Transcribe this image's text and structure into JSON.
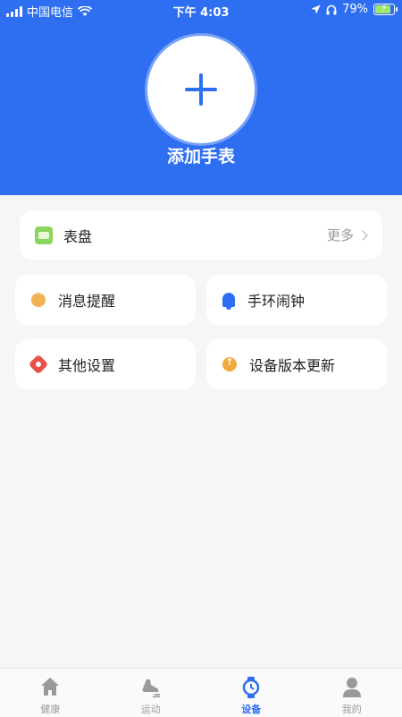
{
  "status_bar": {
    "carrier": "中国电信",
    "time": "下午 4:03",
    "battery": "79%",
    "battery_level": 0.79
  },
  "header": {
    "add_label": "添加手表",
    "accent": "#2e6ff1"
  },
  "watch_face_card": {
    "label": "表盘",
    "more": "更多",
    "icon": "watch-face-icon"
  },
  "menu": [
    {
      "label": "消息提醒",
      "icon": "message-bubble-icon"
    },
    {
      "label": "手环闹钟",
      "icon": "bell-icon"
    },
    {
      "label": "其他设置",
      "icon": "gear-icon"
    },
    {
      "label": "设备版本更新",
      "icon": "update-icon"
    }
  ],
  "tabbar": [
    {
      "label": "健康",
      "icon": "home-icon",
      "active": false
    },
    {
      "label": "运动",
      "icon": "running-shoe-icon",
      "active": false
    },
    {
      "label": "设备",
      "icon": "watch-icon",
      "active": true
    },
    {
      "label": "我的",
      "icon": "user-icon",
      "active": false
    }
  ]
}
